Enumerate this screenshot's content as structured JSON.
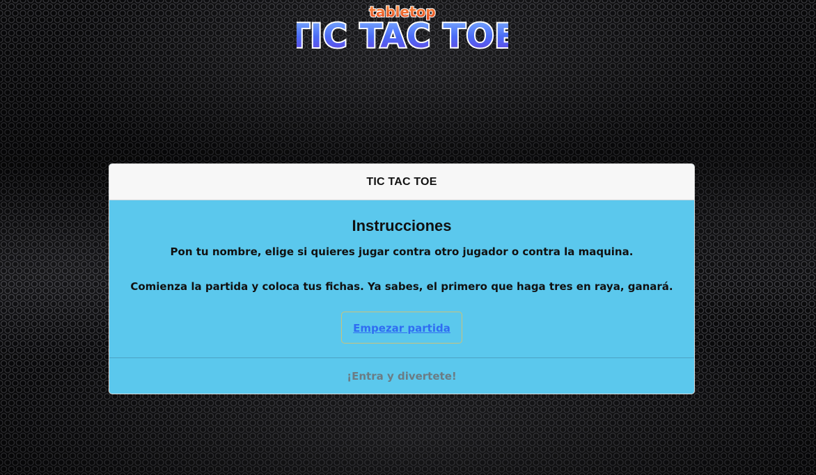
{
  "logo": {
    "small_text": "tabletop",
    "big_text": "TIC TAC TOE"
  },
  "card": {
    "header": "TIC TAC TOE",
    "title": "Instrucciones",
    "line1": "Pon tu nombre, elige si quieres jugar contra otro jugador o contra la maquina.",
    "line2": "Comienza la partida y coloca tus fichas. Ya sabes, el primero que haga tres en raya, ganará.",
    "button_label": "Empezar partida",
    "footer": "¡Entra y divertete!"
  },
  "colors": {
    "card_body": "#5bc8ed",
    "card_header": "#f7f7f7",
    "link": "#2f6df2",
    "footer_text": "#6b7c84",
    "logo_blue": "#4f6bf5",
    "logo_orange": "#f05a28"
  }
}
